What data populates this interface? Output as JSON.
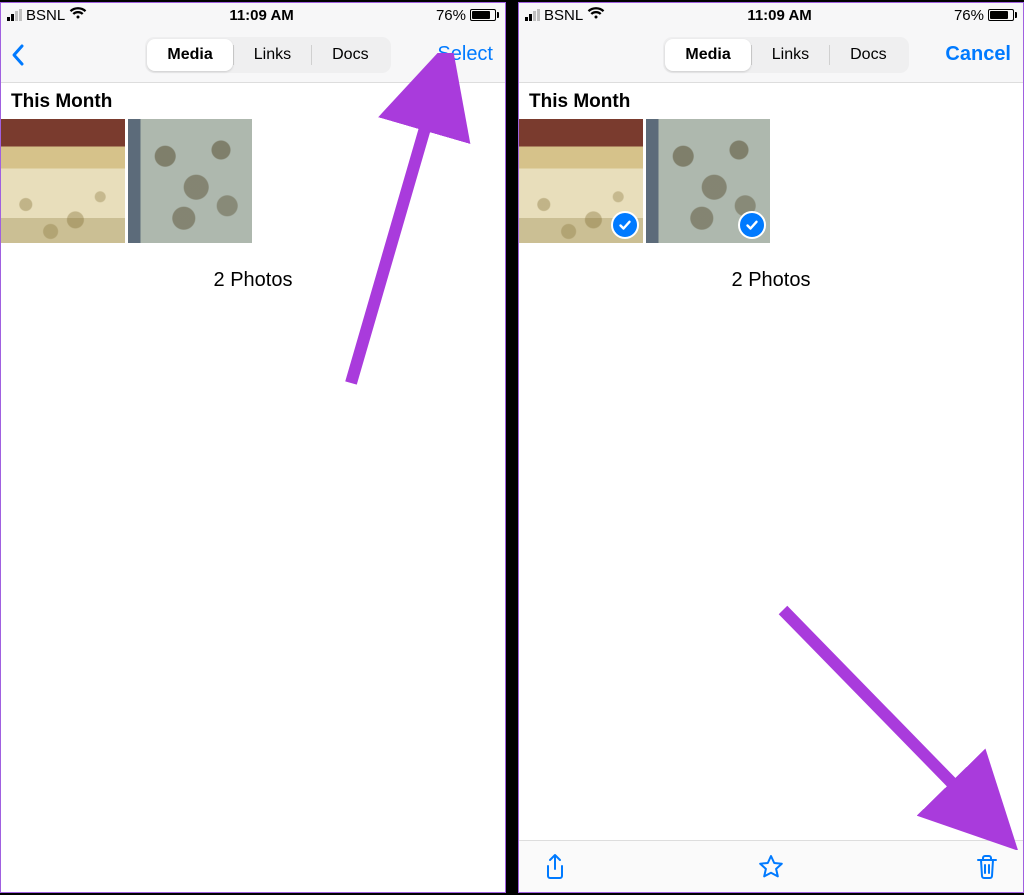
{
  "left": {
    "status": {
      "carrier": "BSNL",
      "time": "11:09 AM",
      "battery_pct": "76%",
      "battery_fill_pct": 76
    },
    "nav": {
      "tabs": {
        "media": "Media",
        "links": "Links",
        "docs": "Docs"
      },
      "right_action": "Select"
    },
    "section_title": "This Month",
    "count_label": "2 Photos"
  },
  "right": {
    "status": {
      "carrier": "BSNL",
      "time": "11:09 AM",
      "battery_pct": "76%",
      "battery_fill_pct": 76
    },
    "nav": {
      "tabs": {
        "media": "Media",
        "links": "Links",
        "docs": "Docs"
      },
      "right_action": "Cancel"
    },
    "section_title": "This Month",
    "count_label": "2 Photos"
  },
  "annotation_color": "#a93bdc"
}
